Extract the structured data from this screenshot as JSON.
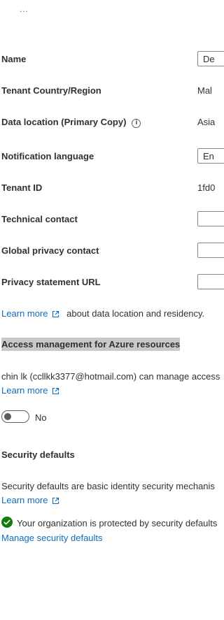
{
  "header": {
    "overflow_label": "..."
  },
  "fields": {
    "name": {
      "label": "Name",
      "value": "De"
    },
    "tenant_country": {
      "label": "Tenant Country/Region",
      "value": "Mal"
    },
    "data_location": {
      "label": "Data location (Primary Copy)",
      "value": "Asia"
    },
    "notification_language": {
      "label": "Notification language",
      "value": "En"
    },
    "tenant_id": {
      "label": "Tenant ID",
      "value": "1fd0"
    },
    "technical_contact": {
      "label": "Technical contact",
      "value": ""
    },
    "global_privacy_contact": {
      "label": "Global privacy contact",
      "value": ""
    },
    "privacy_statement_url": {
      "label": "Privacy statement URL",
      "value": ""
    }
  },
  "data_location_note": {
    "link": "Learn more",
    "text": "about data location and residency."
  },
  "access_management": {
    "title": "Access management for Azure resources",
    "description": "chin lk (ccllkk3377@hotmail.com) can manage access",
    "learn_more": "Learn more",
    "toggle_label": "No",
    "toggle_state": "off"
  },
  "security_defaults": {
    "title": "Security defaults",
    "description": "Security defaults are basic identity security mechanis",
    "learn_more": "Learn more",
    "status": "Your organization is protected by security defaults",
    "manage_link": "Manage security defaults"
  },
  "colors": {
    "link": "#0f6cbd",
    "success": "#107c10",
    "highlight": "#c8c8c8"
  },
  "icons": [
    "ellipsis-icon",
    "info-icon",
    "external-link-icon",
    "success-check-icon"
  ]
}
